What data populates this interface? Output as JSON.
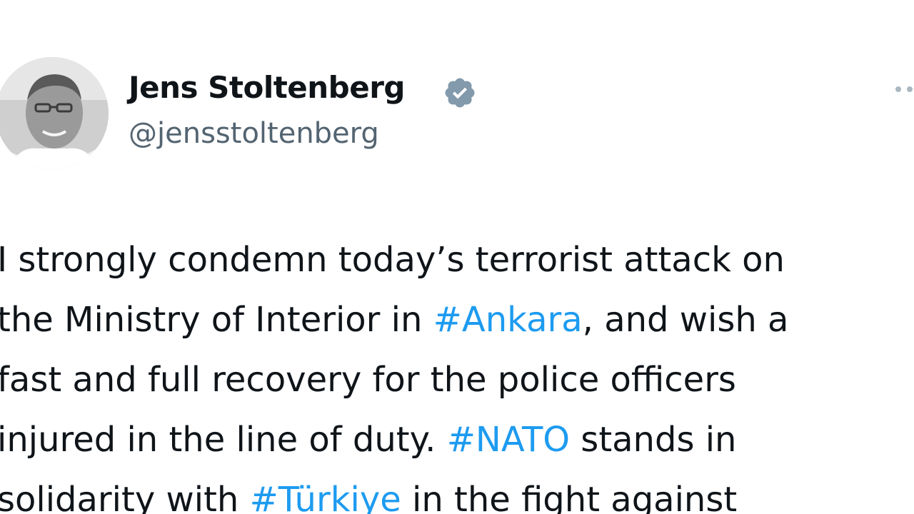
{
  "author": {
    "display_name": "Jens Stoltenberg",
    "handle": "@jensstoltenberg",
    "verified": true
  },
  "tweet": {
    "lines": [
      [
        {
          "text": "I strongly condemn today’s terrorist attack on",
          "type": "text"
        }
      ],
      [
        {
          "text": "the Ministry of Interior in ",
          "type": "text"
        },
        {
          "text": "#Ankara",
          "type": "hashtag"
        },
        {
          "text": ", and wish a",
          "type": "text"
        }
      ],
      [
        {
          "text": "fast and full recovery for the police officers",
          "type": "text"
        }
      ],
      [
        {
          "text": "injured in the line of duty. ",
          "type": "text"
        },
        {
          "text": "#NATO",
          "type": "hashtag"
        },
        {
          "text": " stands in",
          "type": "text"
        }
      ],
      [
        {
          "text": "solidarity with ",
          "type": "text"
        },
        {
          "text": "#Türkiye",
          "type": "hashtag"
        },
        {
          "text": " in the fight against",
          "type": "text"
        }
      ]
    ]
  },
  "colors": {
    "text": "#0f1419",
    "handle": "#536471",
    "hashtag": "#1d9bf0",
    "verified_badge": "#829aab"
  },
  "icons": {
    "verified": "verified-badge-icon",
    "more": "more-options-icon"
  }
}
